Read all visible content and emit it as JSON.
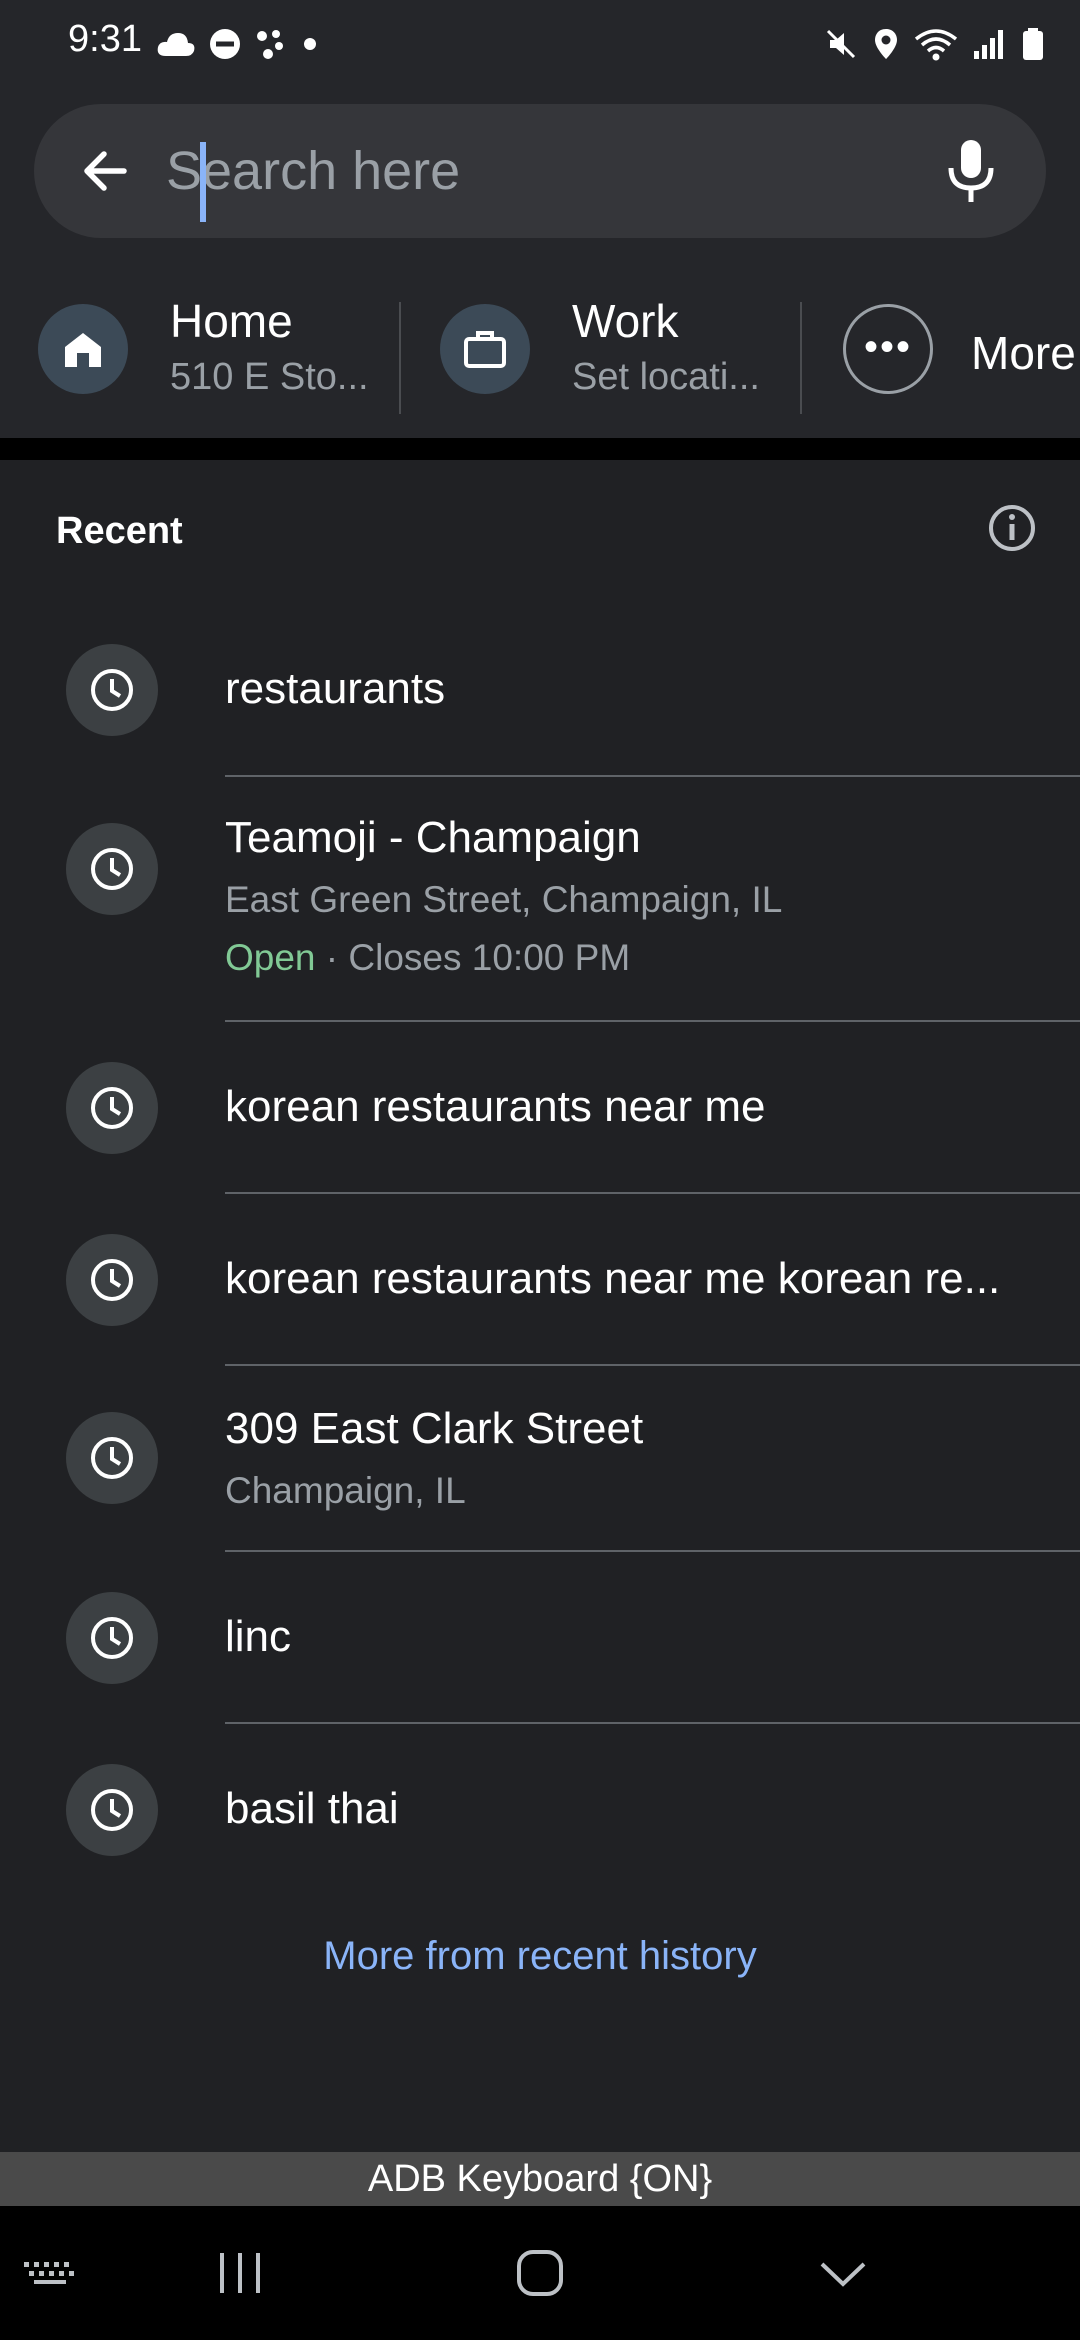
{
  "status_bar": {
    "time": "9:31",
    "left_icons": [
      "cloud-icon",
      "do-not-disturb-icon",
      "dots-app-icon",
      "dot-icon"
    ],
    "right_icons": [
      "mute-icon",
      "location-icon",
      "wifi-icon",
      "signal-icon",
      "battery-icon"
    ]
  },
  "search": {
    "placeholder": "Search here",
    "value": ""
  },
  "shortcuts": {
    "home": {
      "title": "Home",
      "subtitle": "510 E Sto..."
    },
    "work": {
      "title": "Work",
      "subtitle": "Set locati..."
    },
    "more": {
      "title": "More"
    }
  },
  "recent": {
    "heading": "Recent",
    "items": [
      {
        "title": "restaurants"
      },
      {
        "title": "Teamoji - Champaign",
        "subtitle": "East Green Street, Champaign, IL",
        "open_label": "Open",
        "hours": " · Closes 10:00 PM"
      },
      {
        "title": "korean restaurants near me"
      },
      {
        "title": "korean restaurants near me korean re..."
      },
      {
        "title": "309 East Clark Street",
        "subtitle": "Champaign, IL"
      },
      {
        "title": "linc"
      },
      {
        "title": "basil thai"
      }
    ],
    "more_link": "More from recent history"
  },
  "keyboard_bar": "ADB Keyboard {ON}",
  "colors": {
    "background": "#202124",
    "accent": "#8ab4f8",
    "open_green": "#81c995"
  }
}
